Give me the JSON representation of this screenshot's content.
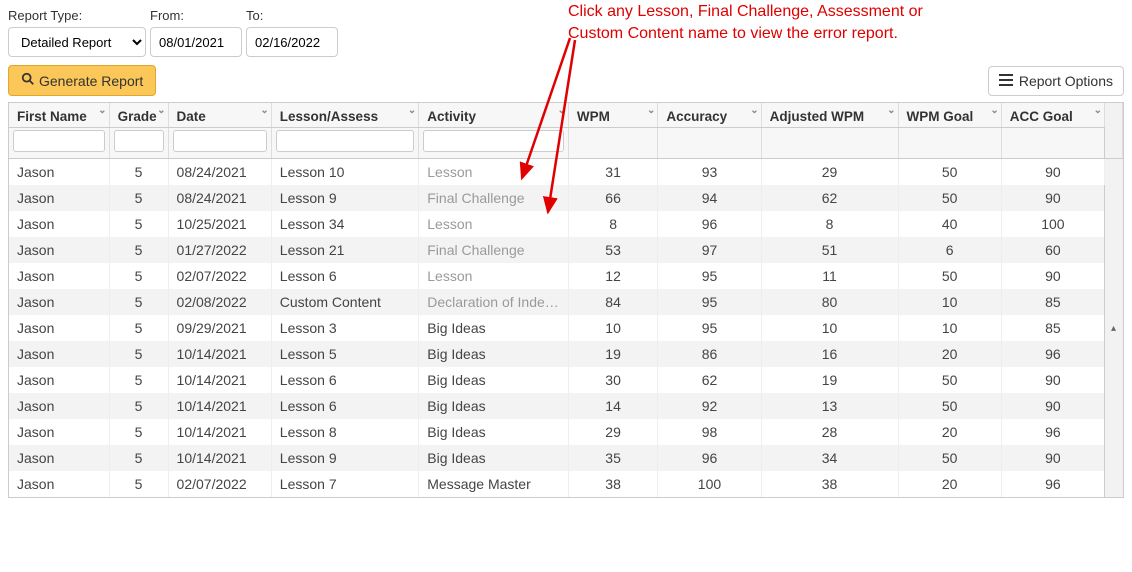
{
  "controls": {
    "reportType": {
      "label": "Report Type:",
      "value": "Detailed Report"
    },
    "from": {
      "label": "From:",
      "value": "08/01/2021"
    },
    "to": {
      "label": "To:",
      "value": "02/16/2022"
    },
    "generate": "Generate Report",
    "options": "Report Options"
  },
  "annotation": {
    "text1": "Click any Lesson, Final Challenge, Assessment or",
    "text2": "Custom Content name to view the error report."
  },
  "columns": [
    "First Name",
    "Grade",
    "Date",
    "Lesson/Assess",
    "Activity",
    "WPM",
    "Accuracy",
    "Adjusted WPM",
    "WPM Goal",
    "ACC Goal"
  ],
  "rows": [
    {
      "first": "Jason",
      "grade": "5",
      "date": "08/24/2021",
      "lesson": "Lesson 10",
      "activity": "Lesson",
      "link": true,
      "wpm": "31",
      "acc": "93",
      "adj": "29",
      "wpmg": "50",
      "accg": "90"
    },
    {
      "first": "Jason",
      "grade": "5",
      "date": "08/24/2021",
      "lesson": "Lesson 9",
      "activity": "Final Challenge",
      "link": true,
      "wpm": "66",
      "acc": "94",
      "adj": "62",
      "wpmg": "50",
      "accg": "90"
    },
    {
      "first": "Jason",
      "grade": "5",
      "date": "10/25/2021",
      "lesson": "Lesson 34",
      "activity": "Lesson",
      "link": true,
      "wpm": "8",
      "acc": "96",
      "adj": "8",
      "wpmg": "40",
      "accg": "100"
    },
    {
      "first": "Jason",
      "grade": "5",
      "date": "01/27/2022",
      "lesson": "Lesson 21",
      "activity": "Final Challenge",
      "link": true,
      "wpm": "53",
      "acc": "97",
      "adj": "51",
      "wpmg": "6",
      "accg": "60"
    },
    {
      "first": "Jason",
      "grade": "5",
      "date": "02/07/2022",
      "lesson": "Lesson 6",
      "activity": "Lesson",
      "link": true,
      "wpm": "12",
      "acc": "95",
      "adj": "11",
      "wpmg": "50",
      "accg": "90"
    },
    {
      "first": "Jason",
      "grade": "5",
      "date": "02/08/2022",
      "lesson": "Custom Content",
      "activity": "Declaration of Indep…",
      "link": true,
      "wpm": "84",
      "acc": "95",
      "adj": "80",
      "wpmg": "10",
      "accg": "85"
    },
    {
      "first": "Jason",
      "grade": "5",
      "date": "09/29/2021",
      "lesson": "Lesson 3",
      "activity": "Big Ideas",
      "link": false,
      "wpm": "10",
      "acc": "95",
      "adj": "10",
      "wpmg": "10",
      "accg": "85"
    },
    {
      "first": "Jason",
      "grade": "5",
      "date": "10/14/2021",
      "lesson": "Lesson 5",
      "activity": "Big Ideas",
      "link": false,
      "wpm": "19",
      "acc": "86",
      "adj": "16",
      "wpmg": "20",
      "accg": "96"
    },
    {
      "first": "Jason",
      "grade": "5",
      "date": "10/14/2021",
      "lesson": "Lesson 6",
      "activity": "Big Ideas",
      "link": false,
      "wpm": "30",
      "acc": "62",
      "adj": "19",
      "wpmg": "50",
      "accg": "90"
    },
    {
      "first": "Jason",
      "grade": "5",
      "date": "10/14/2021",
      "lesson": "Lesson 6",
      "activity": "Big Ideas",
      "link": false,
      "wpm": "14",
      "acc": "92",
      "adj": "13",
      "wpmg": "50",
      "accg": "90"
    },
    {
      "first": "Jason",
      "grade": "5",
      "date": "10/14/2021",
      "lesson": "Lesson 8",
      "activity": "Big Ideas",
      "link": false,
      "wpm": "29",
      "acc": "98",
      "adj": "28",
      "wpmg": "20",
      "accg": "96"
    },
    {
      "first": "Jason",
      "grade": "5",
      "date": "10/14/2021",
      "lesson": "Lesson 9",
      "activity": "Big Ideas",
      "link": false,
      "wpm": "35",
      "acc": "96",
      "adj": "34",
      "wpmg": "50",
      "accg": "90"
    },
    {
      "first": "Jason",
      "grade": "5",
      "date": "02/07/2022",
      "lesson": "Lesson 7",
      "activity": "Message Master",
      "link": false,
      "wpm": "38",
      "acc": "100",
      "adj": "38",
      "wpmg": "20",
      "accg": "96"
    }
  ]
}
